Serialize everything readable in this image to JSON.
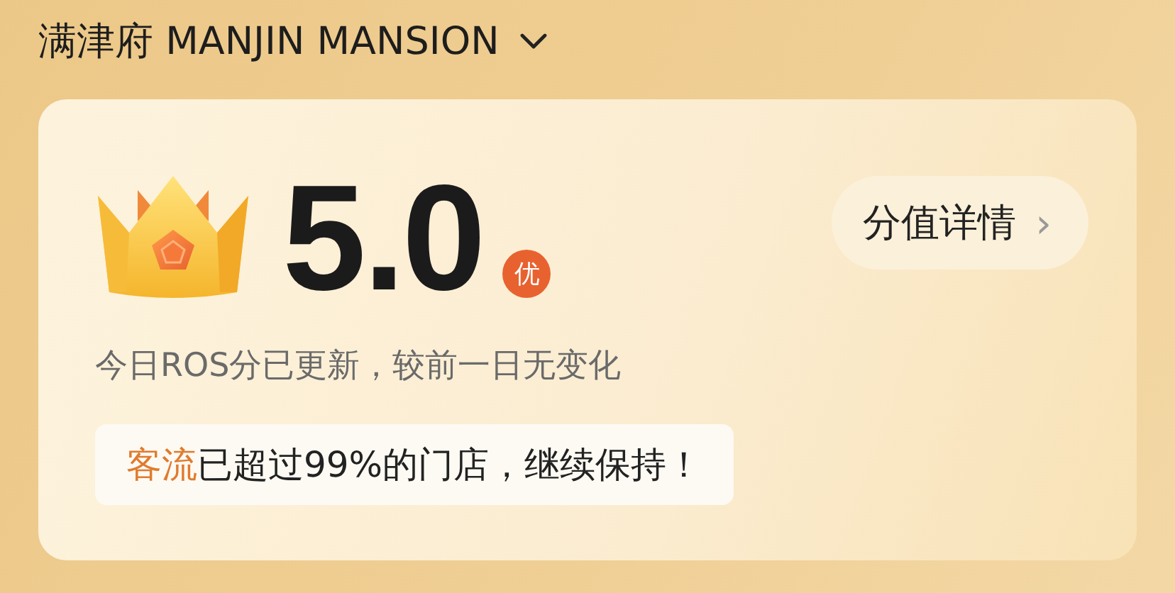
{
  "header": {
    "title": "满津府 MANJIN MANSION"
  },
  "score": {
    "value": "5.0",
    "grade": "优",
    "details_button": "分值详情",
    "chevron": "›"
  },
  "update_note": "今日ROS分已更新，较前一日无变化",
  "tip": {
    "highlight": "客流",
    "text": "已超过99%的门店，继续保持！"
  }
}
